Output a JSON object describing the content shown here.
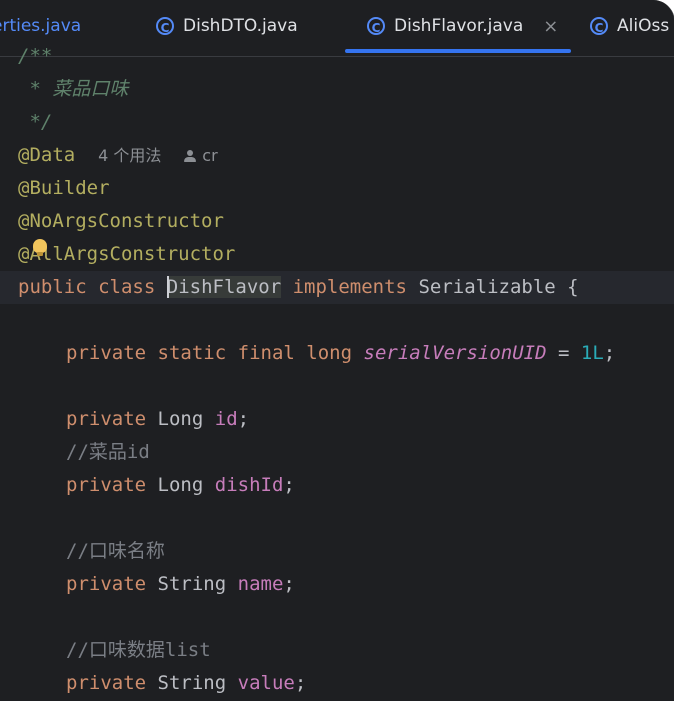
{
  "tabs": [
    {
      "label": "erties.java",
      "active": false
    },
    {
      "label": "DishDTO.java",
      "active": false
    },
    {
      "label": "DishFlavor.java",
      "active": true
    },
    {
      "label": "AliOss",
      "active": false
    }
  ],
  "tab_close_glyph": "×",
  "java_icon_letter": "C",
  "editor": {
    "doc_open": "/**",
    "doc_text": " * 菜品口味",
    "doc_close": " */",
    "ann_data": "@Data",
    "usage_hint": "4 个用法",
    "author_hint": "cr",
    "ann_builder": "@Builder",
    "ann_noargs": "@NoArgsConstructor",
    "ann_allargs": "@AllArgsConstructor",
    "class_public": "public",
    "class_class": "class",
    "class_name": "DishFlavor",
    "class_implements": "implements",
    "class_iface": "Serializable",
    "class_brace": "{",
    "f1_private": "private",
    "f1_static": "static",
    "f1_final": "final",
    "f1_long": "long",
    "f1_name": "serialVersionUID",
    "f1_eq": "=",
    "f1_value": "1L",
    "f1_semi": ";",
    "f2_private": "private",
    "f2_type": "Long",
    "f2_name": "id",
    "f2_semi": ";",
    "c1": "//菜品id",
    "f3_private": "private",
    "f3_type": "Long",
    "f3_name": "dishId",
    "f3_semi": ";",
    "c2": "//口味名称",
    "f4_private": "private",
    "f4_type": "String",
    "f4_name": "name",
    "f4_semi": ";",
    "c3": "//口味数据list",
    "f5_private": "private",
    "f5_type": "String",
    "f5_name": "value",
    "f5_semi": ";"
  },
  "colors": {
    "background": "#1e1f22",
    "keyword": "#cf8e6d",
    "annotation": "#b3ae60",
    "field": "#c77dbb",
    "number": "#2aacb8",
    "comment": "#7a7e85",
    "doc_comment": "#5f826b",
    "accent": "#3574f0"
  },
  "icons": [
    "java-class-icon",
    "close-icon",
    "lightbulb-icon",
    "user-icon"
  ]
}
